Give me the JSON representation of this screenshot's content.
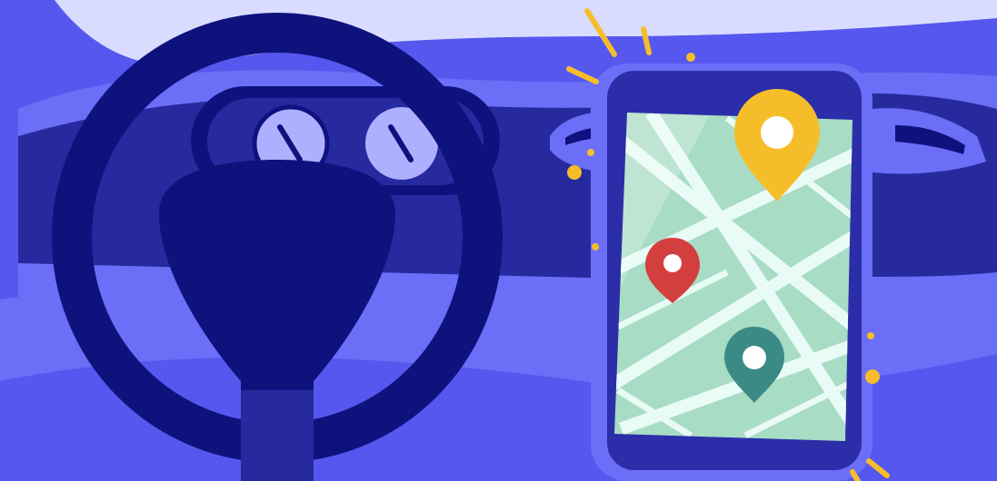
{
  "scene": {
    "description_hidden": false
  },
  "colors": {
    "sky": "#d9dcff",
    "body_light": "#6b6ef6",
    "body_mid": "#5557ee",
    "dash_dark": "#262a9e",
    "dash_navy": "#0f127e",
    "wheel": "#0e127d",
    "gauge_face": "#aeb0ff",
    "phone_frame": "#2b2ea8",
    "phone_bezel": "#7475f8",
    "map_green": "#a8dcc4",
    "map_road": "#e8fbf6",
    "pin_yellow": "#f6bd2b",
    "pin_red": "#d33f3f",
    "pin_teal": "#3a8a86",
    "spark": "#f6bd2b"
  },
  "icons": {
    "destination_pin": "map-pin-yellow-icon",
    "origin_pin": "map-pin-red-icon",
    "waypoint_pin": "map-pin-teal-icon",
    "steering_wheel": "steering-wheel-icon",
    "gauges": "speedometer-icon"
  }
}
